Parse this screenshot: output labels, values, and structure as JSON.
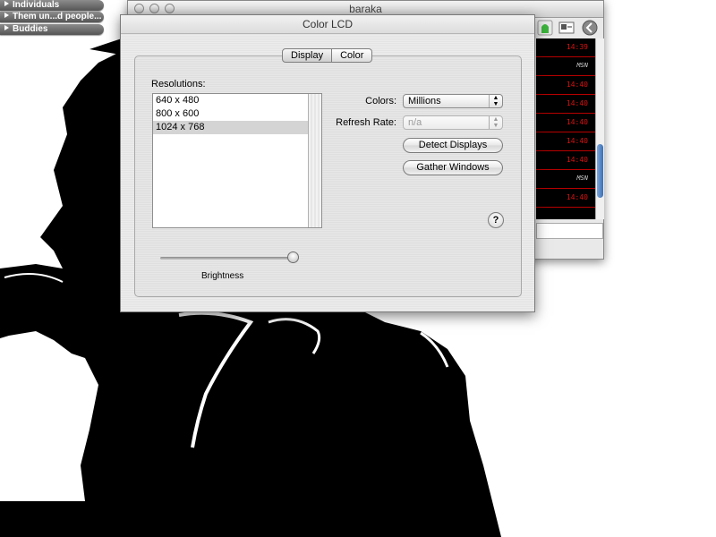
{
  "drawers": [
    {
      "label": "Individuals"
    },
    {
      "label": "Them un...d people..."
    },
    {
      "label": "Buddies"
    }
  ],
  "baraka": {
    "title": "baraka",
    "chat_rows": [
      {
        "time": "14:39",
        "kind": "time"
      },
      {
        "time": "MSN",
        "kind": "msn"
      },
      {
        "time": "14:40",
        "kind": "time"
      },
      {
        "time": "14:40",
        "kind": "time"
      },
      {
        "time": "14:40",
        "kind": "time"
      },
      {
        "time": "14:40",
        "kind": "time"
      },
      {
        "time": "14:40",
        "kind": "time"
      },
      {
        "time": "MSN",
        "kind": "msn"
      },
      {
        "time": "14:40",
        "kind": "time"
      }
    ],
    "icons": [
      "status-green-icon",
      "card-icon",
      "back-icon"
    ]
  },
  "lcd": {
    "title": "Color LCD",
    "tabs": [
      {
        "label": "Display",
        "active": true
      },
      {
        "label": "Color",
        "active": false
      }
    ],
    "resolutions_label": "Resolutions:",
    "resolutions": [
      {
        "label": "640 x 480",
        "selected": false
      },
      {
        "label": "800 x 600",
        "selected": false
      },
      {
        "label": "1024 x 768",
        "selected": true
      }
    ],
    "colors_label": "Colors:",
    "colors_value": "Millions",
    "refresh_label": "Refresh Rate:",
    "refresh_value": "n/a",
    "detect_button": "Detect Displays",
    "gather_button": "Gather Windows",
    "help_symbol": "?",
    "brightness_label": "Brightness",
    "brightness_level": 0.98
  },
  "colors": {
    "chat_background": "#000000",
    "chat_time": "#dd1111",
    "selection": "#d4d4d4"
  }
}
